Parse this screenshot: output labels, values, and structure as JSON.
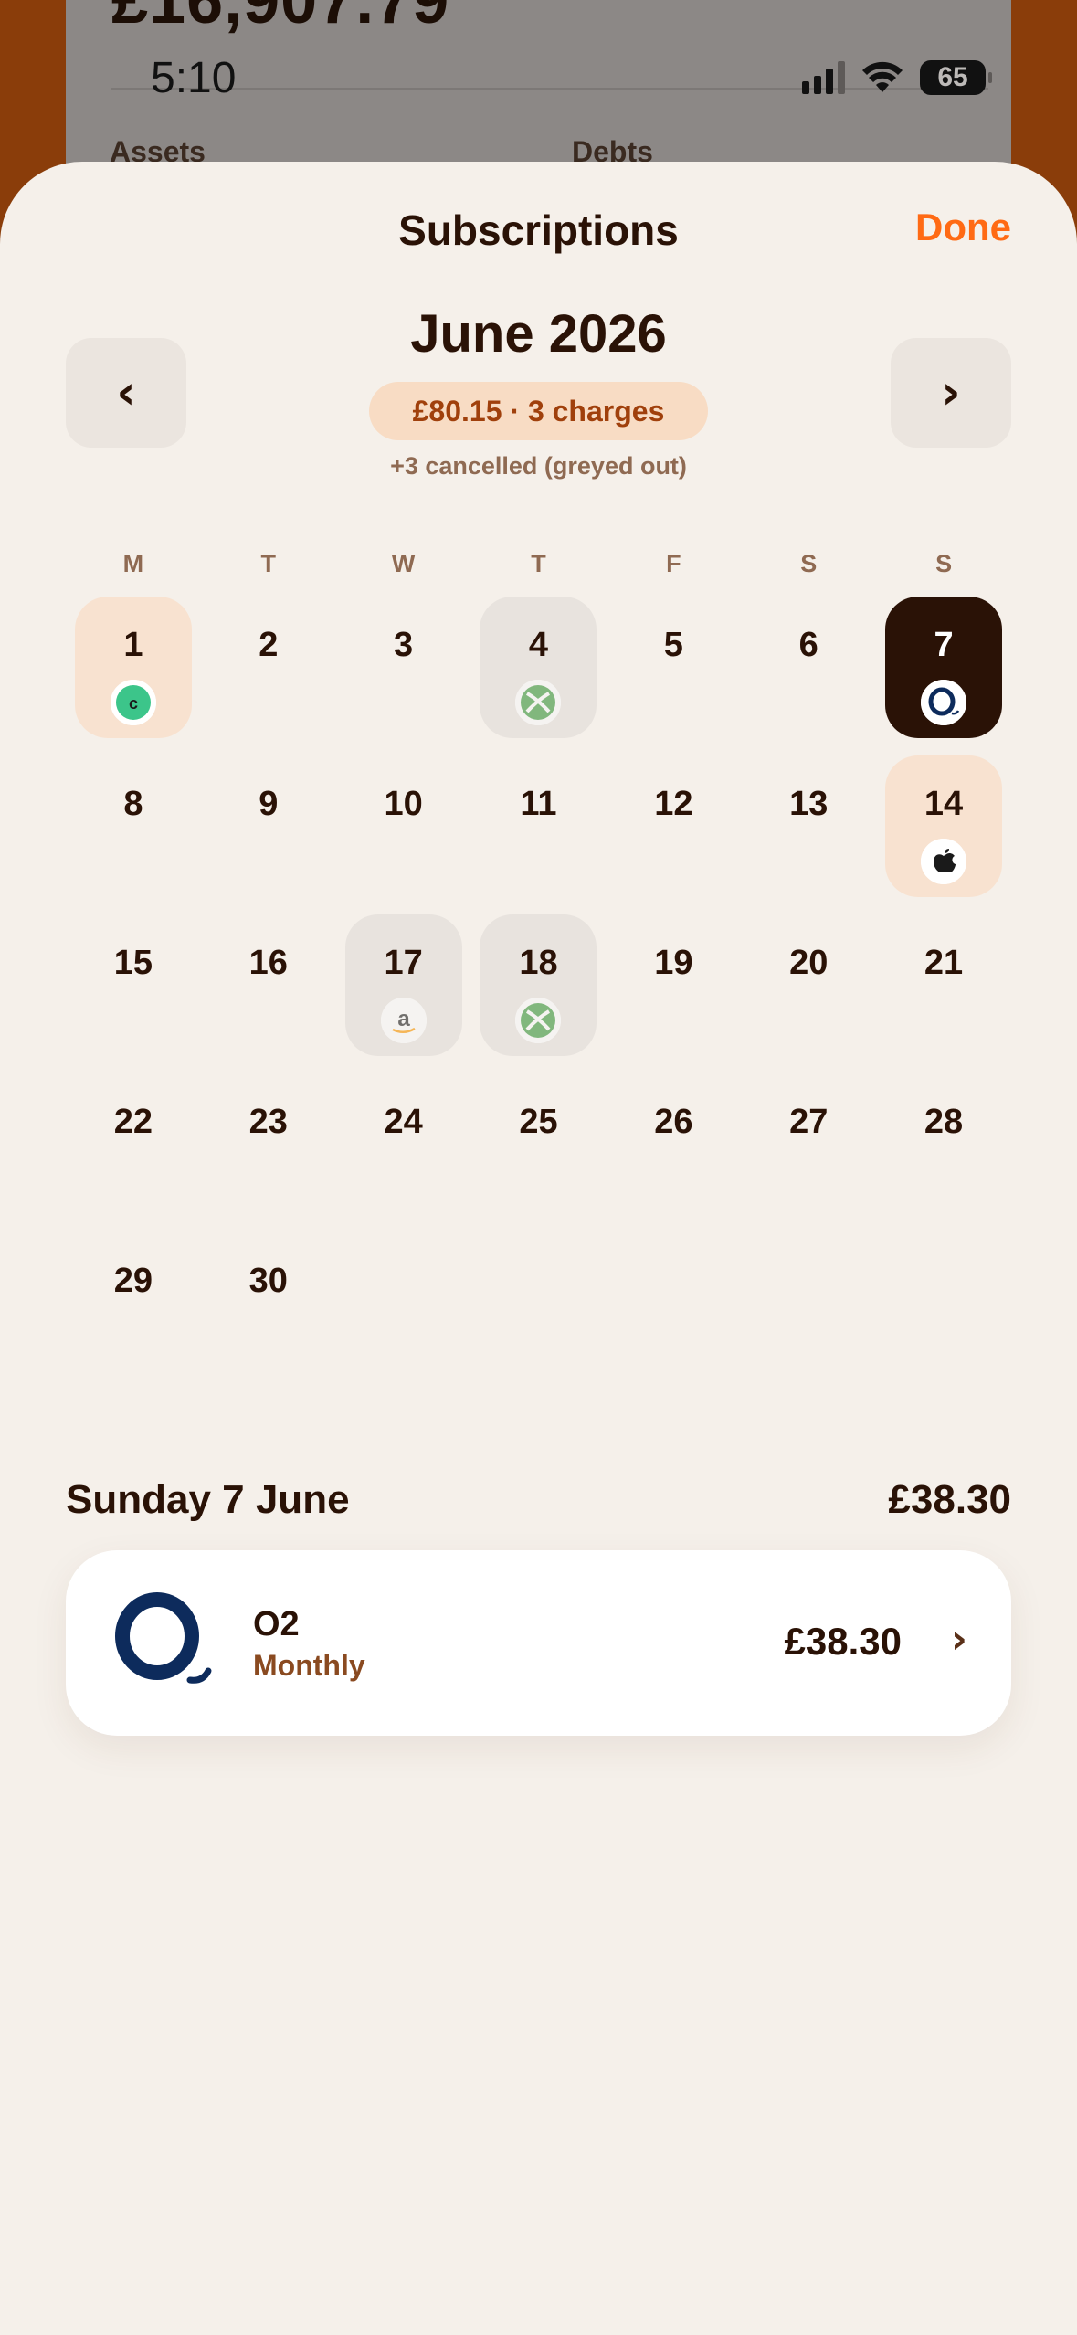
{
  "background": {
    "amount": "£16,907.79",
    "assets_label": "Assets",
    "debts_label": "Debts"
  },
  "status_bar": {
    "time": "5:10",
    "battery": "65"
  },
  "sheet": {
    "title": "Subscriptions",
    "done_label": "Done",
    "month_title": "June 2026",
    "prev_label": "‹",
    "next_label": "›",
    "summary": "£80.15 · 3 charges",
    "cancelled_note": "+3 cancelled (greyed out)"
  },
  "calendar": {
    "weekdays": [
      "M",
      "T",
      "W",
      "T",
      "F",
      "S",
      "S"
    ],
    "days": [
      {
        "num": "1",
        "state": "charge",
        "icon": "c-logo-icon"
      },
      {
        "num": "2"
      },
      {
        "num": "3"
      },
      {
        "num": "4",
        "state": "cancelled",
        "icon": "xbox-icon"
      },
      {
        "num": "5"
      },
      {
        "num": "6"
      },
      {
        "num": "7",
        "state": "selected",
        "icon": "o2-icon"
      },
      {
        "num": "8"
      },
      {
        "num": "9"
      },
      {
        "num": "10"
      },
      {
        "num": "11"
      },
      {
        "num": "12"
      },
      {
        "num": "13"
      },
      {
        "num": "14",
        "state": "charge",
        "icon": "apple-icon"
      },
      {
        "num": "15"
      },
      {
        "num": "16"
      },
      {
        "num": "17",
        "state": "cancelled",
        "icon": "amazon-icon"
      },
      {
        "num": "18",
        "state": "cancelled",
        "icon": "xbox-icon"
      },
      {
        "num": "19"
      },
      {
        "num": "20"
      },
      {
        "num": "21"
      },
      {
        "num": "22"
      },
      {
        "num": "23"
      },
      {
        "num": "24"
      },
      {
        "num": "25"
      },
      {
        "num": "26"
      },
      {
        "num": "27"
      },
      {
        "num": "28"
      },
      {
        "num": "29"
      },
      {
        "num": "30"
      }
    ]
  },
  "detail": {
    "date": "Sunday 7 June",
    "total": "£38.30",
    "items": [
      {
        "name": "O2",
        "frequency": "Monthly",
        "amount": "£38.30",
        "icon": "o2-icon"
      }
    ]
  },
  "colors": {
    "accent": "#ff6a14",
    "sheet_bg": "#f5f0ea",
    "charge_bg": "#f8e2d0",
    "cancelled_bg": "#e8e3de",
    "selected_bg": "#2a1206"
  }
}
